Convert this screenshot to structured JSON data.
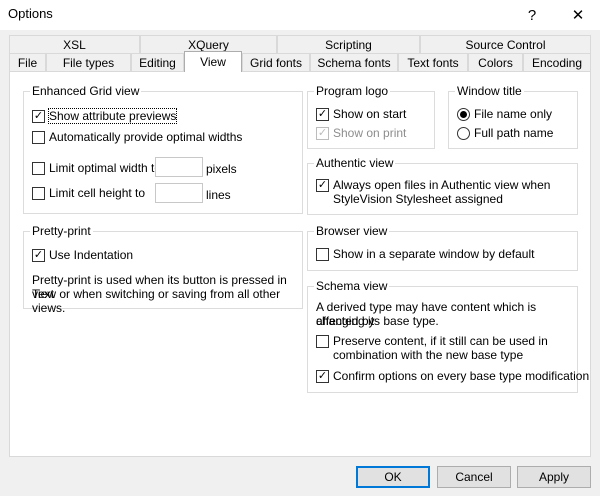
{
  "window": {
    "title": "Options",
    "help_glyph": "?",
    "close_glyph": "✕"
  },
  "tabs_row1": [
    {
      "label": "XSL"
    },
    {
      "label": "XQuery"
    },
    {
      "label": "Scripting"
    },
    {
      "label": "Source Control"
    }
  ],
  "tabs_row2": [
    {
      "label": "File"
    },
    {
      "label": "File types"
    },
    {
      "label": "Editing"
    },
    {
      "label": "View"
    },
    {
      "label": "Grid fonts"
    },
    {
      "label": "Schema fonts"
    },
    {
      "label": "Text fonts"
    },
    {
      "label": "Colors"
    },
    {
      "label": "Encoding"
    }
  ],
  "enhanced_grid": {
    "title": "Enhanced Grid view",
    "show_attr": {
      "label": "Show attribute previews",
      "checked": true
    },
    "auto_widths": {
      "label": "Automatically provide optimal widths",
      "checked": false
    },
    "limit_width": {
      "label": "Limit optimal width to",
      "checked": false,
      "value": "",
      "unit": "pixels"
    },
    "limit_height": {
      "label": "Limit cell height to",
      "checked": false,
      "value": "",
      "unit": "lines"
    }
  },
  "program_logo": {
    "title": "Program logo",
    "show_start": {
      "label": "Show on start",
      "checked": true
    },
    "show_print": {
      "label": "Show on print",
      "checked": true,
      "disabled": true
    }
  },
  "window_title": {
    "title": "Window title",
    "file_name_only": {
      "label": "File name only",
      "selected": true
    },
    "full_path": {
      "label": "Full path name",
      "selected": false
    }
  },
  "authentic": {
    "title": "Authentic view",
    "always_open": {
      "label_line1": "Always open files in Authentic view when",
      "label_line2": "StyleVision Stylesheet assigned",
      "checked": true
    }
  },
  "pretty_print": {
    "title": "Pretty-print",
    "use_indent": {
      "label": "Use Indentation",
      "checked": true
    },
    "desc_line1": "Pretty-print is used when its button is pressed in Text",
    "desc_line2": "view or when switching or saving from all other views."
  },
  "browser": {
    "title": "Browser view",
    "separate_window": {
      "label": "Show in a separate window by default",
      "checked": false
    }
  },
  "schema": {
    "title": "Schema view",
    "desc_line1": "A derived type may have content which is affected by",
    "desc_line2": "changing its base type.",
    "preserve": {
      "label_line1": "Preserve content, if it still can be used in",
      "label_line2": "combination with the new base type",
      "checked": false
    },
    "confirm": {
      "label": "Confirm options on every base type modification",
      "checked": true
    }
  },
  "buttons": {
    "ok": "OK",
    "cancel": "Cancel",
    "apply": "Apply"
  },
  "check_glyph": "✓"
}
